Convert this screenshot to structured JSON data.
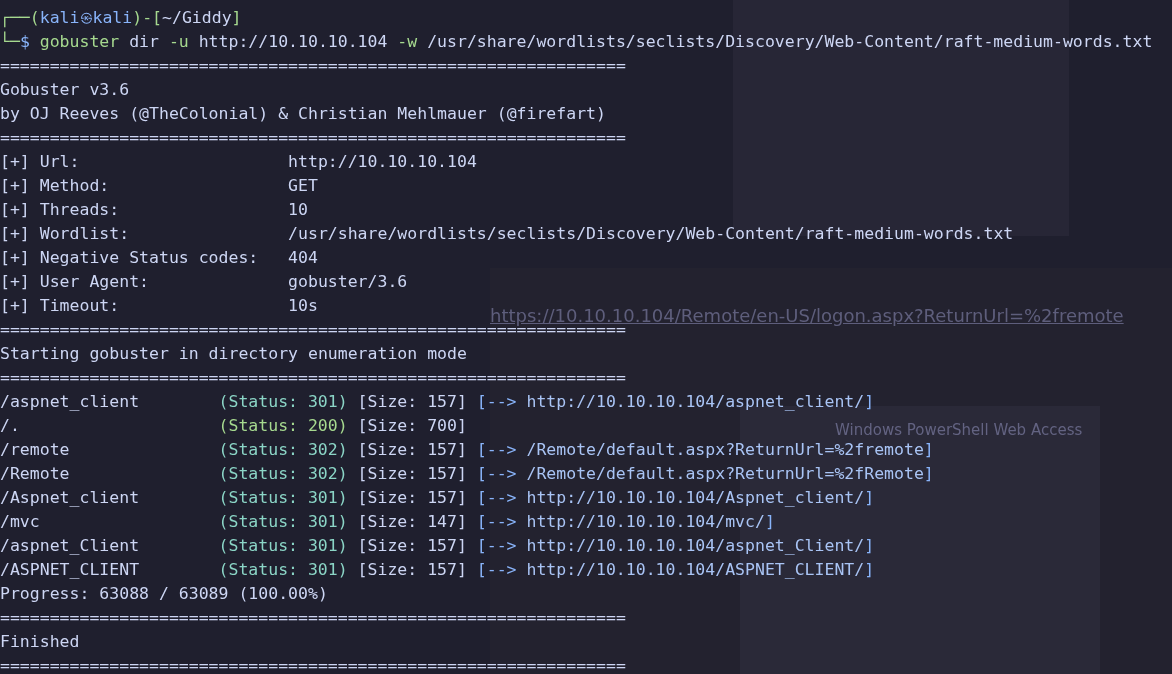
{
  "background": {
    "url_heading": "https://10.10.10.104/Remote/en-US/logon.aspx?ReturnUrl=%2fremote",
    "dialog_title": "Windows PowerShell Web Access"
  },
  "prompt": {
    "corner_top": "┌──(",
    "user": "kali",
    "at": "㉿",
    "host": "kali",
    "bracket_open": ")-[",
    "path": "~/Giddy",
    "bracket_close": "]",
    "corner_bottom": "└─",
    "symbol": "$"
  },
  "command": {
    "program": "gobuster",
    "args": [
      {
        "kind": "word",
        "text": "dir"
      },
      {
        "kind": "flag",
        "text": "-u"
      },
      {
        "kind": "word",
        "text": "http://10.10.10.104"
      },
      {
        "kind": "flag",
        "text": "-w"
      },
      {
        "kind": "word",
        "text": "/usr/share/wordlists/seclists/Discovery/Web-Content/raft-medium-words.txt"
      }
    ]
  },
  "lines": [
    {
      "kind": "rule",
      "text": "==============================================================="
    },
    {
      "kind": "text",
      "text": "Gobuster v3.6"
    },
    {
      "kind": "text",
      "text": "by OJ Reeves (@TheColonial) & Christian Mehlmauer (@firefart)"
    },
    {
      "kind": "rule",
      "text": "==============================================================="
    },
    {
      "kind": "setting",
      "label": "[+] Url:",
      "value": "http://10.10.10.104"
    },
    {
      "kind": "setting",
      "label": "[+] Method:",
      "value": "GET"
    },
    {
      "kind": "setting",
      "label": "[+] Threads:",
      "value": "10"
    },
    {
      "kind": "setting",
      "label": "[+] Wordlist:",
      "value": "/usr/share/wordlists/seclists/Discovery/Web-Content/raft-medium-words.txt"
    },
    {
      "kind": "setting",
      "label": "[+] Negative Status codes:",
      "value": "404"
    },
    {
      "kind": "setting",
      "label": "[+] User Agent:",
      "value": "gobuster/3.6"
    },
    {
      "kind": "setting",
      "label": "[+] Timeout:",
      "value": "10s"
    },
    {
      "kind": "rule",
      "text": "==============================================================="
    },
    {
      "kind": "text",
      "text": "Starting gobuster in directory enumeration mode"
    },
    {
      "kind": "rule",
      "text": "==============================================================="
    },
    {
      "kind": "result",
      "path": "/aspnet_client",
      "status": "(Status: 301)",
      "color": "#8bd5c6",
      "size": "[Size: 157]",
      "redirect": {
        "open": "[-->",
        "target": "http://10.10.10.104/aspnet_client/",
        "close": "]"
      }
    },
    {
      "kind": "result",
      "path": "/.",
      "status": "(Status: 200)",
      "color": "#a6d98f",
      "size": "[Size: 700]"
    },
    {
      "kind": "result",
      "path": "/remote",
      "status": "(Status: 302)",
      "color": "#8bd5c6",
      "size": "[Size: 157]",
      "redirect": {
        "open": "[-->",
        "target": "/Remote/default.aspx?ReturnUrl=%2fremote",
        "close": "]"
      }
    },
    {
      "kind": "result",
      "path": "/Remote",
      "status": "(Status: 302)",
      "color": "#8bd5c6",
      "size": "[Size: 157]",
      "redirect": {
        "open": "[-->",
        "target": "/Remote/default.aspx?ReturnUrl=%2fRemote",
        "close": "]"
      }
    },
    {
      "kind": "result",
      "path": "/Aspnet_client",
      "status": "(Status: 301)",
      "color": "#8bd5c6",
      "size": "[Size: 157]",
      "redirect": {
        "open": "[-->",
        "target": "http://10.10.10.104/Aspnet_client/",
        "close": "]"
      }
    },
    {
      "kind": "result",
      "path": "/mvc",
      "status": "(Status: 301)",
      "color": "#8bd5c6",
      "size": "[Size: 147]",
      "redirect": {
        "open": "[-->",
        "target": "http://10.10.10.104/mvc/",
        "close": "]"
      }
    },
    {
      "kind": "result",
      "path": "/aspnet_Client",
      "status": "(Status: 301)",
      "color": "#8bd5c6",
      "size": "[Size: 157]",
      "redirect": {
        "open": "[-->",
        "target": "http://10.10.10.104/aspnet_Client/",
        "close": "]"
      }
    },
    {
      "kind": "result",
      "path": "/ASPNET_CLIENT",
      "status": "(Status: 301)",
      "color": "#8bd5c6",
      "size": "[Size: 157]",
      "redirect": {
        "open": "[-->",
        "target": "http://10.10.10.104/ASPNET_CLIENT/",
        "close": "]"
      }
    },
    {
      "kind": "text",
      "text": "Progress: 63088 / 63089 (100.00%)"
    },
    {
      "kind": "rule",
      "text": "==============================================================="
    },
    {
      "kind": "text",
      "text": "Finished"
    },
    {
      "kind": "rule",
      "text": "==============================================================="
    }
  ]
}
